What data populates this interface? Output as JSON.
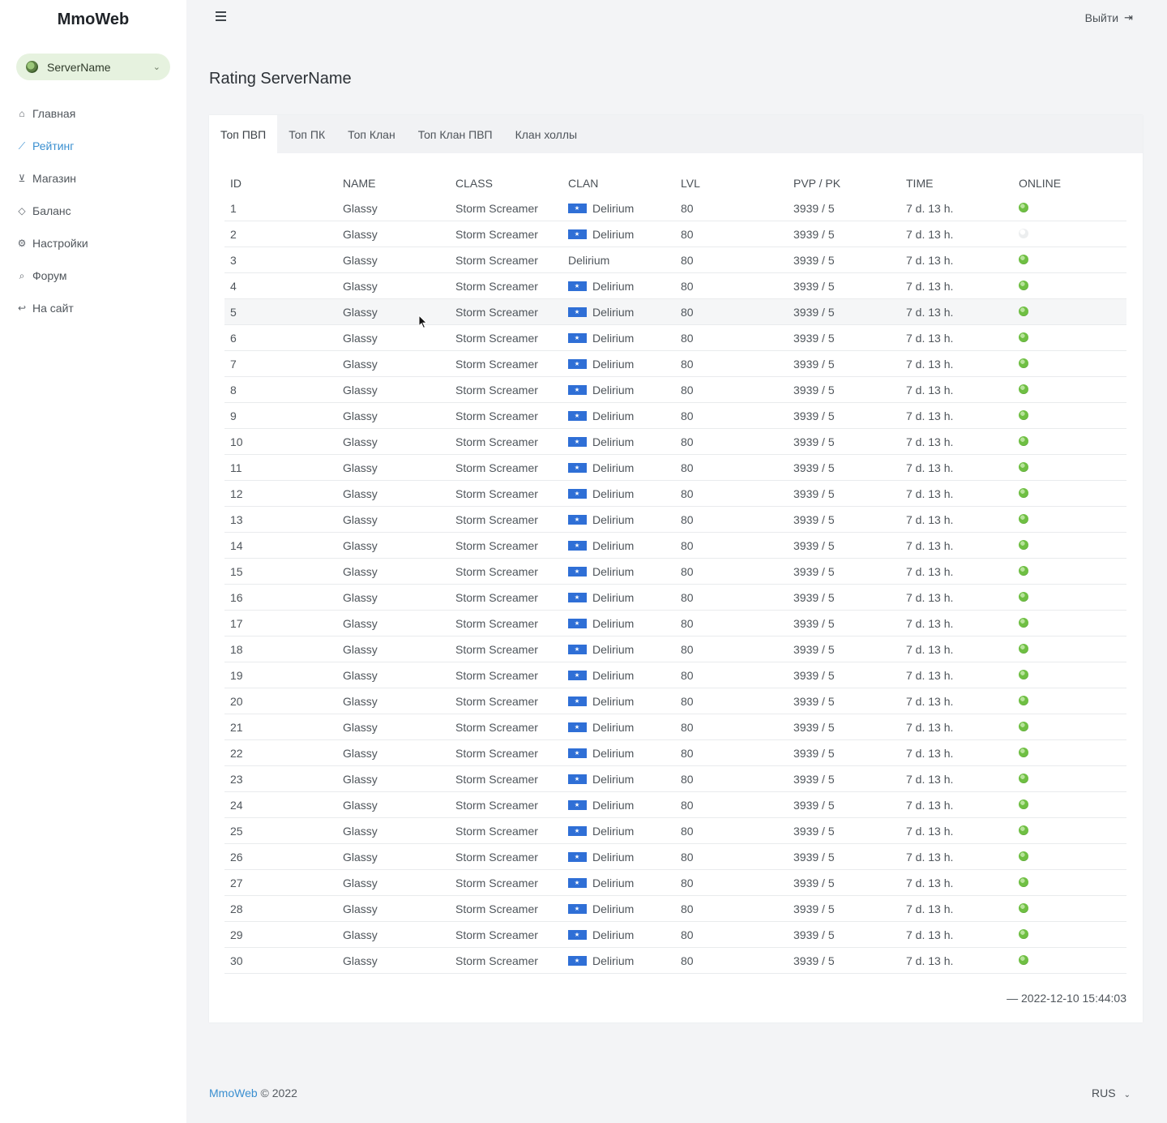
{
  "app": {
    "brand": "MmoWeb"
  },
  "server_select": {
    "value": "ServerName"
  },
  "sidebar": {
    "items": [
      {
        "label": "Главная",
        "icon": "home-icon",
        "glyph": "⌂"
      },
      {
        "label": "Рейтинг",
        "icon": "chart-line-icon",
        "glyph": "⟋"
      },
      {
        "label": "Магазин",
        "icon": "cart-icon",
        "glyph": "⊻"
      },
      {
        "label": "Баланс",
        "icon": "diamond-icon",
        "glyph": "◇"
      },
      {
        "label": "Настройки",
        "icon": "gear-icon",
        "glyph": "⚙"
      },
      {
        "label": "Форум",
        "icon": "comments-icon",
        "glyph": "⌕"
      },
      {
        "label": "На сайт",
        "icon": "reply-icon",
        "glyph": "↩"
      }
    ],
    "active_index": 1
  },
  "header": {
    "logout_label": "Выйти"
  },
  "page": {
    "title": "Rating ServerName"
  },
  "tabs": [
    "Топ ПВП",
    "Топ ПК",
    "Топ Клан",
    "Топ Клан ПВП",
    "Клан холлы"
  ],
  "table": {
    "columns": [
      "ID",
      "NAME",
      "CLASS",
      "CLAN",
      "LVL",
      "PVP / PK",
      "TIME",
      "ONLINE"
    ],
    "rows": [
      {
        "id": "1",
        "name": "Glassy",
        "class": "Storm Screamer",
        "clan": "Delirium",
        "flag": true,
        "lvl": "80",
        "pvp_pk": "3939 / 5",
        "time": "7 d. 13 h.",
        "online": true
      },
      {
        "id": "2",
        "name": "Glassy",
        "class": "Storm Screamer",
        "clan": "Delirium",
        "flag": true,
        "lvl": "80",
        "pvp_pk": "3939 / 5",
        "time": "7 d. 13 h.",
        "online": false
      },
      {
        "id": "3",
        "name": "Glassy",
        "class": "Storm Screamer",
        "clan": "Delirium",
        "flag": false,
        "lvl": "80",
        "pvp_pk": "3939 / 5",
        "time": "7 d. 13 h.",
        "online": true
      },
      {
        "id": "4",
        "name": "Glassy",
        "class": "Storm Screamer",
        "clan": "Delirium",
        "flag": true,
        "lvl": "80",
        "pvp_pk": "3939 / 5",
        "time": "7 d. 13 h.",
        "online": true
      },
      {
        "id": "5",
        "name": "Glassy",
        "class": "Storm Screamer",
        "clan": "Delirium",
        "flag": true,
        "lvl": "80",
        "pvp_pk": "3939 / 5",
        "time": "7 d. 13 h.",
        "online": true
      },
      {
        "id": "6",
        "name": "Glassy",
        "class": "Storm Screamer",
        "clan": "Delirium",
        "flag": true,
        "lvl": "80",
        "pvp_pk": "3939 / 5",
        "time": "7 d. 13 h.",
        "online": true
      },
      {
        "id": "7",
        "name": "Glassy",
        "class": "Storm Screamer",
        "clan": "Delirium",
        "flag": true,
        "lvl": "80",
        "pvp_pk": "3939 / 5",
        "time": "7 d. 13 h.",
        "online": true
      },
      {
        "id": "8",
        "name": "Glassy",
        "class": "Storm Screamer",
        "clan": "Delirium",
        "flag": true,
        "lvl": "80",
        "pvp_pk": "3939 / 5",
        "time": "7 d. 13 h.",
        "online": true
      },
      {
        "id": "9",
        "name": "Glassy",
        "class": "Storm Screamer",
        "clan": "Delirium",
        "flag": true,
        "lvl": "80",
        "pvp_pk": "3939 / 5",
        "time": "7 d. 13 h.",
        "online": true
      },
      {
        "id": "10",
        "name": "Glassy",
        "class": "Storm Screamer",
        "clan": "Delirium",
        "flag": true,
        "lvl": "80",
        "pvp_pk": "3939 / 5",
        "time": "7 d. 13 h.",
        "online": true
      },
      {
        "id": "11",
        "name": "Glassy",
        "class": "Storm Screamer",
        "clan": "Delirium",
        "flag": true,
        "lvl": "80",
        "pvp_pk": "3939 / 5",
        "time": "7 d. 13 h.",
        "online": true
      },
      {
        "id": "12",
        "name": "Glassy",
        "class": "Storm Screamer",
        "clan": "Delirium",
        "flag": true,
        "lvl": "80",
        "pvp_pk": "3939 / 5",
        "time": "7 d. 13 h.",
        "online": true
      },
      {
        "id": "13",
        "name": "Glassy",
        "class": "Storm Screamer",
        "clan": "Delirium",
        "flag": true,
        "lvl": "80",
        "pvp_pk": "3939 / 5",
        "time": "7 d. 13 h.",
        "online": true
      },
      {
        "id": "14",
        "name": "Glassy",
        "class": "Storm Screamer",
        "clan": "Delirium",
        "flag": true,
        "lvl": "80",
        "pvp_pk": "3939 / 5",
        "time": "7 d. 13 h.",
        "online": true
      },
      {
        "id": "15",
        "name": "Glassy",
        "class": "Storm Screamer",
        "clan": "Delirium",
        "flag": true,
        "lvl": "80",
        "pvp_pk": "3939 / 5",
        "time": "7 d. 13 h.",
        "online": true
      },
      {
        "id": "16",
        "name": "Glassy",
        "class": "Storm Screamer",
        "clan": "Delirium",
        "flag": true,
        "lvl": "80",
        "pvp_pk": "3939 / 5",
        "time": "7 d. 13 h.",
        "online": true
      },
      {
        "id": "17",
        "name": "Glassy",
        "class": "Storm Screamer",
        "clan": "Delirium",
        "flag": true,
        "lvl": "80",
        "pvp_pk": "3939 / 5",
        "time": "7 d. 13 h.",
        "online": true
      },
      {
        "id": "18",
        "name": "Glassy",
        "class": "Storm Screamer",
        "clan": "Delirium",
        "flag": true,
        "lvl": "80",
        "pvp_pk": "3939 / 5",
        "time": "7 d. 13 h.",
        "online": true
      },
      {
        "id": "19",
        "name": "Glassy",
        "class": "Storm Screamer",
        "clan": "Delirium",
        "flag": true,
        "lvl": "80",
        "pvp_pk": "3939 / 5",
        "time": "7 d. 13 h.",
        "online": true
      },
      {
        "id": "20",
        "name": "Glassy",
        "class": "Storm Screamer",
        "clan": "Delirium",
        "flag": true,
        "lvl": "80",
        "pvp_pk": "3939 / 5",
        "time": "7 d. 13 h.",
        "online": true
      },
      {
        "id": "21",
        "name": "Glassy",
        "class": "Storm Screamer",
        "clan": "Delirium",
        "flag": true,
        "lvl": "80",
        "pvp_pk": "3939 / 5",
        "time": "7 d. 13 h.",
        "online": true
      },
      {
        "id": "22",
        "name": "Glassy",
        "class": "Storm Screamer",
        "clan": "Delirium",
        "flag": true,
        "lvl": "80",
        "pvp_pk": "3939 / 5",
        "time": "7 d. 13 h.",
        "online": true
      },
      {
        "id": "23",
        "name": "Glassy",
        "class": "Storm Screamer",
        "clan": "Delirium",
        "flag": true,
        "lvl": "80",
        "pvp_pk": "3939 / 5",
        "time": "7 d. 13 h.",
        "online": true
      },
      {
        "id": "24",
        "name": "Glassy",
        "class": "Storm Screamer",
        "clan": "Delirium",
        "flag": true,
        "lvl": "80",
        "pvp_pk": "3939 / 5",
        "time": "7 d. 13 h.",
        "online": true
      },
      {
        "id": "25",
        "name": "Glassy",
        "class": "Storm Screamer",
        "clan": "Delirium",
        "flag": true,
        "lvl": "80",
        "pvp_pk": "3939 / 5",
        "time": "7 d. 13 h.",
        "online": true
      },
      {
        "id": "26",
        "name": "Glassy",
        "class": "Storm Screamer",
        "clan": "Delirium",
        "flag": true,
        "lvl": "80",
        "pvp_pk": "3939 / 5",
        "time": "7 d. 13 h.",
        "online": true
      },
      {
        "id": "27",
        "name": "Glassy",
        "class": "Storm Screamer",
        "clan": "Delirium",
        "flag": true,
        "lvl": "80",
        "pvp_pk": "3939 / 5",
        "time": "7 d. 13 h.",
        "online": true
      },
      {
        "id": "28",
        "name": "Glassy",
        "class": "Storm Screamer",
        "clan": "Delirium",
        "flag": true,
        "lvl": "80",
        "pvp_pk": "3939 / 5",
        "time": "7 d. 13 h.",
        "online": true
      },
      {
        "id": "29",
        "name": "Glassy",
        "class": "Storm Screamer",
        "clan": "Delirium",
        "flag": true,
        "lvl": "80",
        "pvp_pk": "3939 / 5",
        "time": "7 d. 13 h.",
        "online": true
      },
      {
        "id": "30",
        "name": "Glassy",
        "class": "Storm Screamer",
        "clan": "Delirium",
        "flag": true,
        "lvl": "80",
        "pvp_pk": "3939 / 5",
        "time": "7 d. 13 h.",
        "online": true
      }
    ],
    "hover_row_index": 4,
    "updated": "— 2022-12-10 15:44:03"
  },
  "footer": {
    "brand_link": "MmoWeb",
    "copyright": " © 2022",
    "language": "RUS"
  },
  "colors": {
    "accent": "#3a8fd0",
    "online": "#6fbf43",
    "flag": "#2f6fd6"
  }
}
